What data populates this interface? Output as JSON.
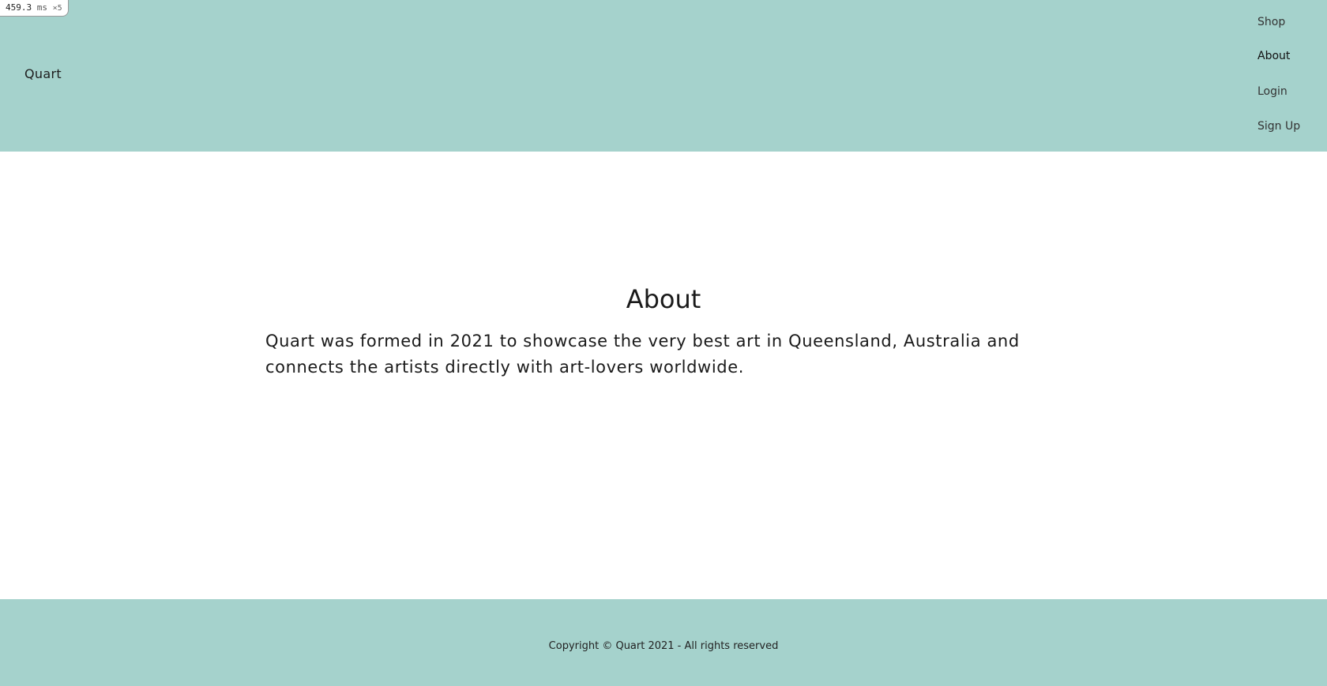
{
  "perf_badge": {
    "value": "459.3",
    "unit": "ms",
    "count": "×5"
  },
  "header": {
    "brand": "Quart",
    "nav": [
      {
        "label": "Shop"
      },
      {
        "label": "About"
      },
      {
        "label": "Login"
      },
      {
        "label": "Sign Up"
      }
    ],
    "background_color": "#a5d2cc"
  },
  "main": {
    "title": "About",
    "body": "Quart was formed in 2021 to showcase the very best art in Queensland, Australia and connects the artists directly with art-lovers worldwide."
  },
  "footer": {
    "copyright": "Copyright © Quart 2021 - All rights reserved",
    "background_color": "#a5d2cc"
  }
}
